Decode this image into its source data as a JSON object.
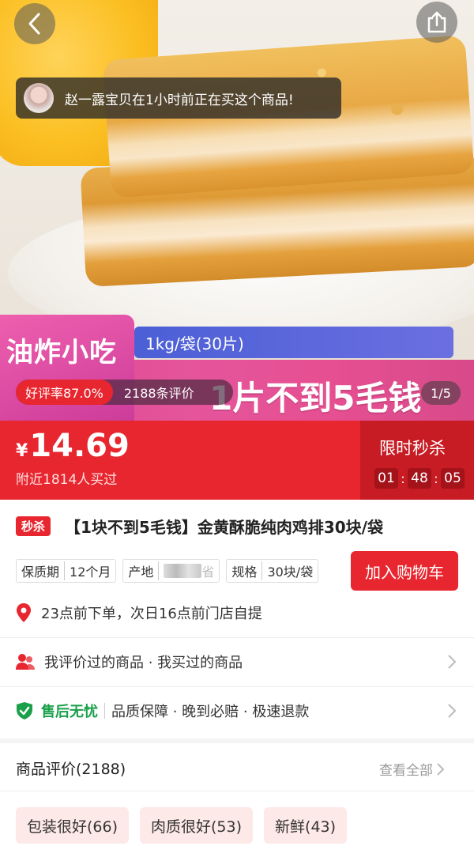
{
  "hero": {
    "ticker_text": "赵一露宝贝在1小时前正在买这个商品!",
    "promo_category": "油炸小吃",
    "spec_strip": "1kg/袋(30片)",
    "slogan": "1片不到5毛钱",
    "good_rate": "好评率87.0%",
    "review_count": "2188条评价",
    "pager": "1/5",
    "icons": {
      "back": "chevron-left-icon",
      "share": "share-icon"
    }
  },
  "price": {
    "currency": "¥",
    "amount": "14.69",
    "bought_nearby": "附近1814人买过",
    "flash_title": "限时秒杀",
    "timer": {
      "h": "01",
      "m": "48",
      "s": "05"
    }
  },
  "product": {
    "tag": "秒杀",
    "title": "【1块不到5毛钱】金黄酥脆纯肉鸡排30块/袋",
    "specs": [
      {
        "k": "保质期",
        "v": "12个月"
      },
      {
        "k": "产地",
        "v": "省"
      },
      {
        "k": "规格",
        "v": "30块/袋"
      }
    ],
    "cart_button": "加入购物车",
    "pickup": "23点前下单，次日16点前门店自提"
  },
  "rows": {
    "history": "我评价过的商品 · 我买过的商品",
    "after_sale_title": "售后无忧",
    "after_sale_detail": "品质保障 · 晚到必赔 · 极速退款"
  },
  "reviews": {
    "title": "商品评价(2188)",
    "see_all": "查看全部",
    "chips": [
      "包装很好(66)",
      "肉质很好(53)",
      "新鲜(43)"
    ]
  },
  "colors": {
    "accent": "#e8262f",
    "flash_bg": "#c81c24",
    "promo_pink": "#e5559c",
    "green": "#1aa04b"
  }
}
